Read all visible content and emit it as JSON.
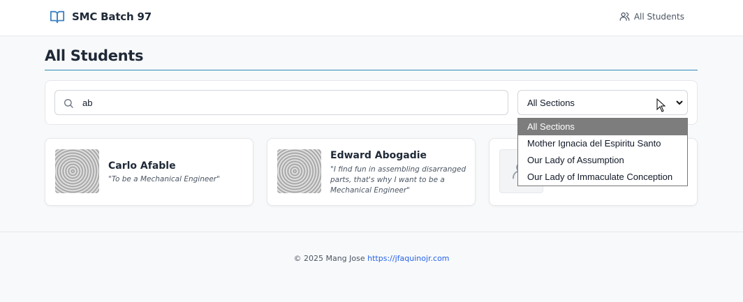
{
  "navbar": {
    "brand": "SMC Batch 97",
    "brand_icon": "open-book-icon",
    "link_label": "All Students",
    "link_icon": "users-icon"
  },
  "page": {
    "title": "All Students",
    "accent_color": "#2b8ab8"
  },
  "filters": {
    "search_value": "ab",
    "search_icon": "search-icon",
    "section_selected": "All Sections",
    "section_options": [
      "All Sections",
      "Mother Ignacia del Espiritu Santo",
      "Our Lady of Assumption",
      "Our Lady of Immaculate Conception"
    ]
  },
  "students": [
    {
      "name": "Carlo Afable",
      "quote": "\"To be a Mechanical Engineer\""
    },
    {
      "name": "Edward Abogadie",
      "quote": "\"I find fun in assembling disarranged parts, that's why I want to be a Mechanical Engineer\""
    },
    {
      "name": "",
      "quote": ""
    }
  ],
  "footer": {
    "copyright": "© 2025 Mang Jose",
    "link_text": "https://jfaquinojr.com",
    "link_color": "#2563eb"
  }
}
